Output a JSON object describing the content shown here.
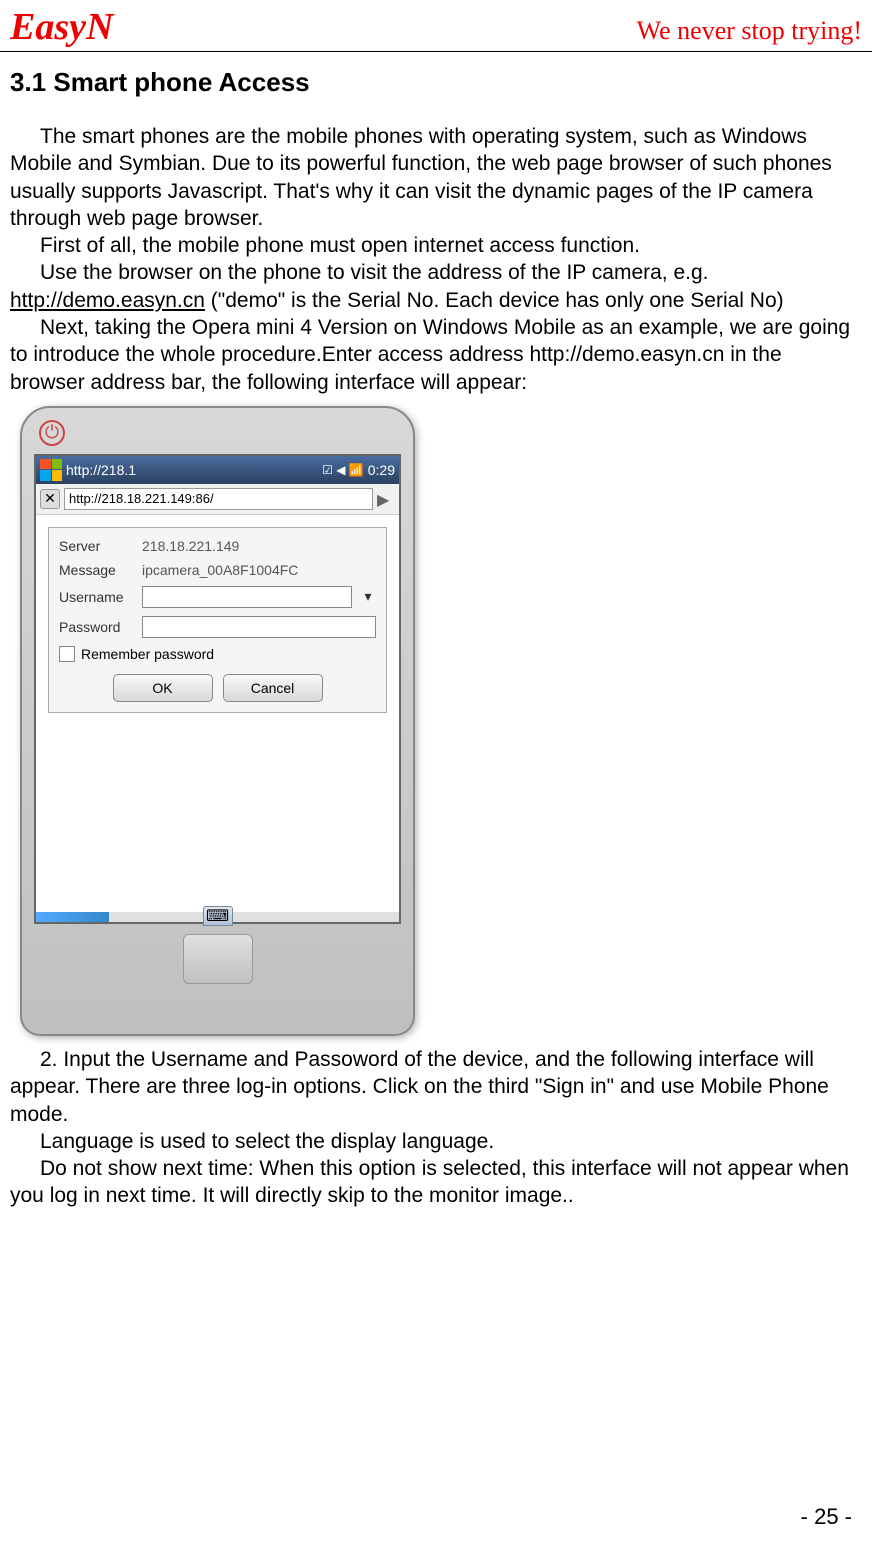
{
  "header": {
    "logo": "EasyN",
    "tagline": "We never stop trying!"
  },
  "section_title": "3.1 Smart phone Access",
  "paragraphs": {
    "p1": "The smart phones are the mobile phones with operating system, such as Windows Mobile and Symbian. Due to its powerful function, the web page browser of such phones usually supports Javascript. That's why it can visit the dynamic pages of the IP camera through web page browser.",
    "p2": "First of all, the mobile phone must open internet access function.",
    "p3a": "Use the browser on the phone to visit the address of the IP camera, e.g. ",
    "p3_link": "http://demo.easyn.cn",
    "p3b": " (\"demo\" is the Serial No. Each device has only one Serial No)",
    "p4": "Next, taking the Opera mini 4 Version on Windows Mobile as an example, we are going to introduce the whole procedure.Enter access address http://demo.easyn.cn in the browser address bar, the following interface will appear:",
    "p5": "2. Input the Username and Passoword of the device, and the following interface will appear. There are three log-in options. Click on the third \"Sign in\" and use Mobile Phone mode.",
    "p6": "Language is used to select the display language.",
    "p7": "Do not show next time: When this option is selected, this interface will not appear when you log in next time. It will directly skip to the monitor image.."
  },
  "phone": {
    "taskbar_url": "http://218.1",
    "taskbar_time": "0:29",
    "address_url": "http://218.18.221.149:86/",
    "dialog": {
      "server_label": "Server",
      "server_value": "218.18.221.149",
      "message_label": "Message",
      "message_value": "ipcamera_00A8F1004FC",
      "username_label": "Username",
      "password_label": "Password",
      "remember": "Remember password",
      "ok": "OK",
      "cancel": "Cancel"
    }
  },
  "page_number": "- 25 -"
}
